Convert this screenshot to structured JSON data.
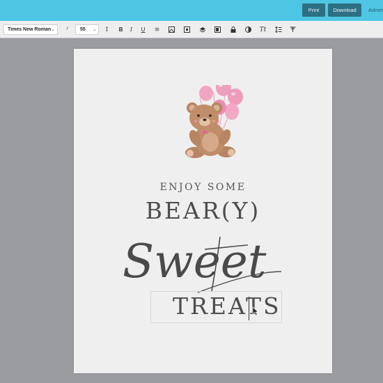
{
  "header": {
    "print_label": "Print",
    "download_label": "Download",
    "admin_label": "Admin"
  },
  "toolbar": {
    "font_family_value": "Times New Roman",
    "font_size_value": "55",
    "icons": [
      "clear-format-icon",
      "letter-spacing-icon",
      "bold-icon",
      "italic-icon",
      "underline-icon",
      "align-icon",
      "image-icon",
      "duplicate-icon",
      "layers-icon",
      "arrange-icon",
      "lock-icon",
      "color-icon",
      "text-transform-icon",
      "line-height-icon",
      "vertical-align-icon"
    ]
  },
  "design": {
    "line1": "ENJOY SOME",
    "line2": "BEAR(Y)",
    "script_word": "Sweet",
    "line4": "TREATS"
  },
  "colors": {
    "topbar": "#4dc6e3",
    "button": "#2d6f83",
    "text": "#4d4d4d",
    "balloon": "#ee9fbd"
  }
}
